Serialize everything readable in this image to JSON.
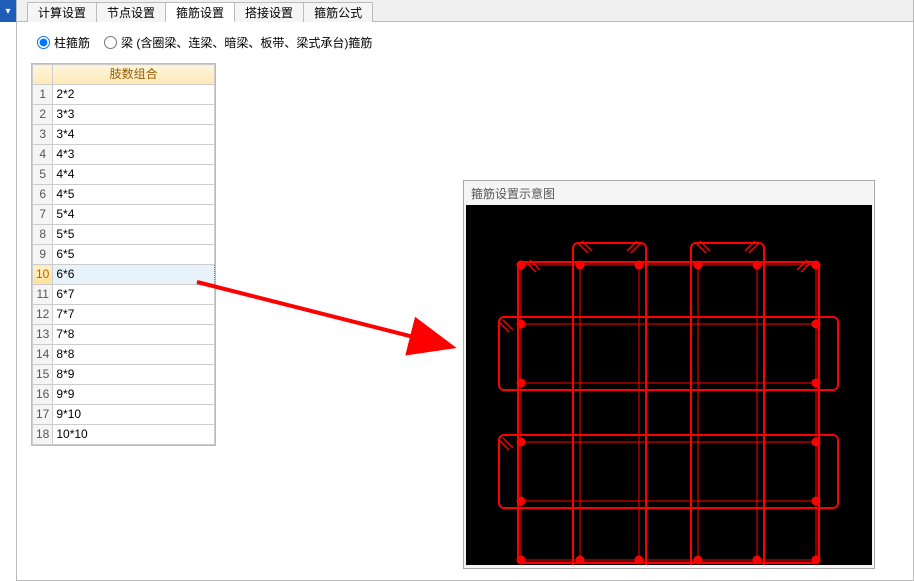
{
  "side_button": "▾",
  "tabs": [
    "计算设置",
    "节点设置",
    "箍筋设置",
    "搭接设置",
    "箍筋公式"
  ],
  "active_tab_index": 2,
  "radios": {
    "column": "柱箍筋",
    "beam": "梁 (含圈梁、连梁、暗梁、板带、梁式承台)箍筋",
    "selected": "column"
  },
  "table": {
    "header": "肢数组合",
    "rows": [
      "2*2",
      "3*3",
      "3*4",
      "4*3",
      "4*4",
      "4*5",
      "5*4",
      "5*5",
      "6*5",
      "6*6",
      "6*7",
      "7*7",
      "7*8",
      "8*8",
      "8*9",
      "9*9",
      "9*10",
      "10*10"
    ],
    "selected_index": 9
  },
  "diagram": {
    "title": "箍筋设置示意图",
    "grid_size": 6,
    "color": "#ff0000",
    "bg": "#000000"
  }
}
